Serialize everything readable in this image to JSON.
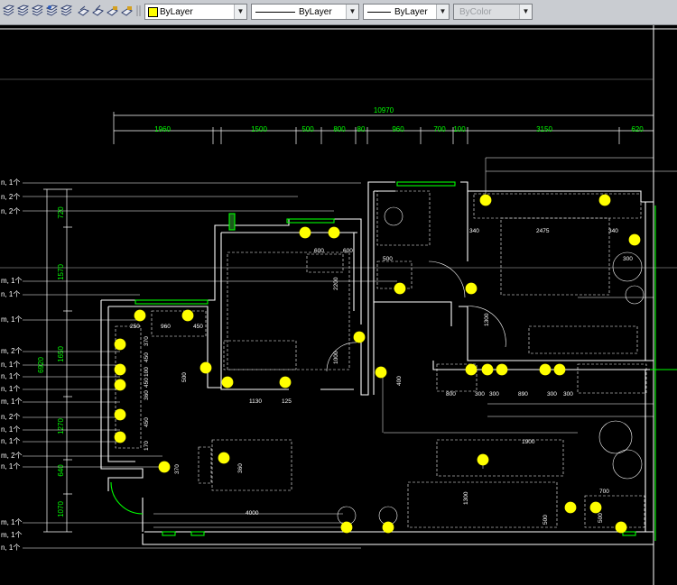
{
  "toolbar": {
    "color_dropdown": {
      "value": "ByLayer",
      "swatch": "#ffff00"
    },
    "linetype_dropdown": {
      "value": "ByLayer"
    },
    "lineweight_dropdown": {
      "value": "ByLayer"
    },
    "plotstyle_dropdown": {
      "value": "ByColor"
    }
  },
  "drawing": {
    "overall_dimension": "10970",
    "top_dimensions": [
      "1960",
      "1500",
      "500",
      "800",
      "80",
      "960",
      "700",
      "100",
      "3150",
      "620"
    ],
    "left_dimensions": [
      "720",
      "1570",
      "1650",
      "1270",
      "640",
      "1070"
    ],
    "left_total": "6920",
    "left_labels": [
      "1个",
      "2个",
      "2个",
      "1个",
      "1个",
      "1个",
      "2个",
      "1个",
      "1个",
      "1个",
      "1个",
      "2个",
      "1个",
      "1个",
      "2个",
      "1个",
      "1个",
      "1个",
      "1个"
    ],
    "room_dimensions": [
      "600",
      "600",
      "2200",
      "500",
      "1000",
      "1130",
      "125",
      "960",
      "250",
      "450",
      "370",
      "450",
      "100",
      "450",
      "360",
      "450",
      "170",
      "370",
      "360",
      "500",
      "400",
      "340",
      "2475",
      "340",
      "300",
      "1300",
      "800",
      "300",
      "300",
      "890",
      "300",
      "300",
      "1900",
      "1300",
      "500",
      "700",
      "500",
      "4000"
    ],
    "colors": {
      "green": "#00ff00",
      "white": "#ffffff",
      "yellow": "#ffff00",
      "gray": "#8c8c8c"
    }
  }
}
